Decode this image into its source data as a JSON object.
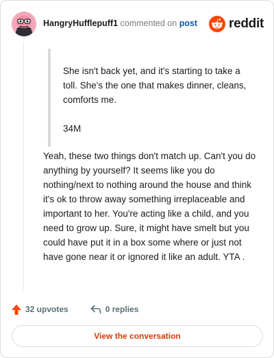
{
  "comment": {
    "username": "HangryHufflepuff1",
    "action_text": "commented on",
    "post_link": "post",
    "quote": [
      "She isn't back yet, and it's starting to take a toll. She's the one that makes dinner, cleans, comforts me.",
      "34M"
    ],
    "body": "Yeah, these two things don't match up. Can't you do anything by yourself? It seems like you do nothing/next to nothing around the house and think it's ok to throw away something irreplaceable and important to her. You're acting like a child, and you need to grow up. Sure, it might have smelt but you could have put it in a box some where or just not have gone near it or ignored it like an adult. YTA ."
  },
  "brand": {
    "logo_text": "reddit",
    "icon": "reddit-snoo-icon",
    "color": "#ff4500"
  },
  "actions": {
    "upvotes": "32 upvotes",
    "replies": "0 replies",
    "upvote_icon": "upvote-arrow-icon",
    "reply_icon": "reply-arrow-icon",
    "upvote_color": "#ff4500"
  },
  "footer": {
    "view_button": "View the conversation",
    "accent": "#d93a00"
  }
}
